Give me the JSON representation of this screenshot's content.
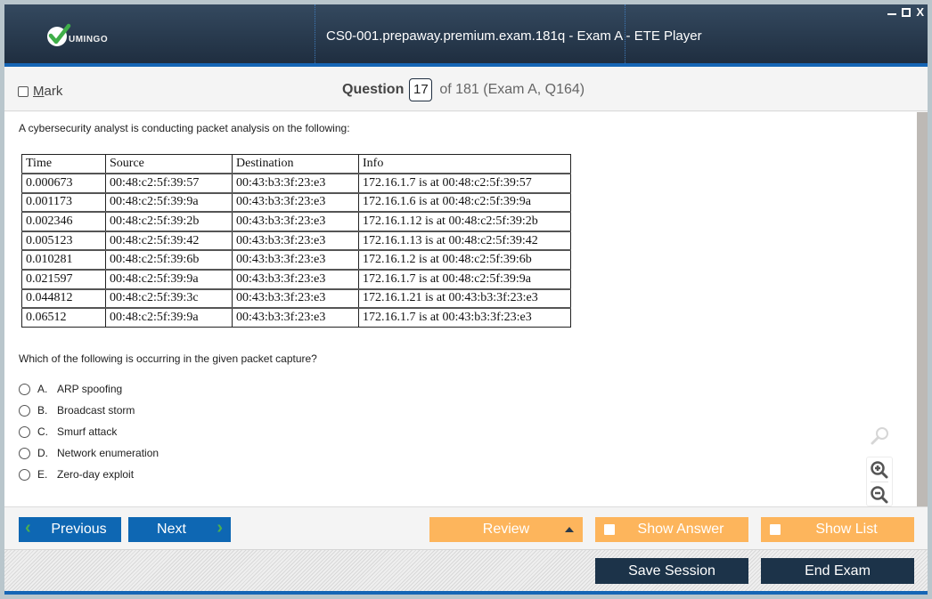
{
  "window": {
    "title": "CS0-001.prepaway.premium.exam.181q - Exam A - ETE Player",
    "brand": "UMINGO",
    "controls": {
      "minimize": "_",
      "maximize": "□",
      "close": "X"
    }
  },
  "header": {
    "mark_label_underlined": "M",
    "mark_label_rest": "ark",
    "mark_checked": false,
    "question_label": "Question",
    "question_number": "17",
    "question_rest": "of 181 (Exam A, Q164)"
  },
  "question": {
    "stem": "A cybersecurity analyst is conducting packet analysis on the following:",
    "table": {
      "headers": [
        "Time",
        "Source",
        "Destination",
        "Info"
      ],
      "rows": [
        [
          "0.000673",
          "00:48:c2:5f:39:57",
          "00:43:b3:3f:23:e3",
          "172.16.1.7 is at 00:48:c2:5f:39:57"
        ],
        [
          "0.001173",
          "00:48:c2:5f:39:9a",
          "00:43:b3:3f:23:e3",
          "172.16.1.6 is at 00:48:c2:5f:39:9a"
        ],
        [
          "0.002346",
          "00:48:c2:5f:39:2b",
          "00:43:b3:3f:23:e3",
          "172.16.1.12 is at 00:48:c2:5f:39:2b"
        ],
        [
          "0.005123",
          "00:48:c2:5f:39:42",
          "00:43:b3:3f:23:e3",
          "172.16.1.13 is at 00:48:c2:5f:39:42"
        ],
        [
          "0.010281",
          "00:48:c2:5f:39:6b",
          "00:43:b3:3f:23:e3",
          "172.16.1.2 is at 00:48:c2:5f:39:6b"
        ],
        [
          "0.021597",
          "00:48:c2:5f:39:9a",
          "00:43:b3:3f:23:e3",
          "172.16.1.7 is at 00:48:c2:5f:39:9a"
        ],
        [
          "0.044812",
          "00:48:c2:5f:39:3c",
          "00:43:b3:3f:23:e3",
          "172.16.1.21 is at 00:43:b3:3f:23:e3"
        ],
        [
          "0.06512",
          "00:48:c2:5f:39:9a",
          "00:43:b3:3f:23:e3",
          "172.16.1.7 is at 00:43:b3:3f:23:e3"
        ]
      ]
    },
    "prompt": "Which of the following is occurring in the given packet capture?",
    "options": [
      {
        "letter": "A.",
        "text": "ARP spoofing"
      },
      {
        "letter": "B.",
        "text": "Broadcast storm"
      },
      {
        "letter": "C.",
        "text": "Smurf attack"
      },
      {
        "letter": "D.",
        "text": "Network enumeration"
      },
      {
        "letter": "E.",
        "text": "Zero-day exploit"
      }
    ]
  },
  "zoom_tools": {
    "search": "search-icon",
    "zoom_in": "zoom-in-icon",
    "zoom_out": "zoom-out-icon"
  },
  "footer": {
    "previous": "Previous",
    "next": "Next",
    "review": "Review",
    "show_answer": "Show Answer",
    "show_list": "Show List",
    "save_session": "Save Session",
    "end_exam": "End Exam"
  },
  "colors": {
    "title_bar": "#2a3b4f",
    "accent_blue": "#0e67b3",
    "orange": "#fdb55c",
    "dark_button": "#1c3349",
    "chevron_green": "#4caf50"
  }
}
